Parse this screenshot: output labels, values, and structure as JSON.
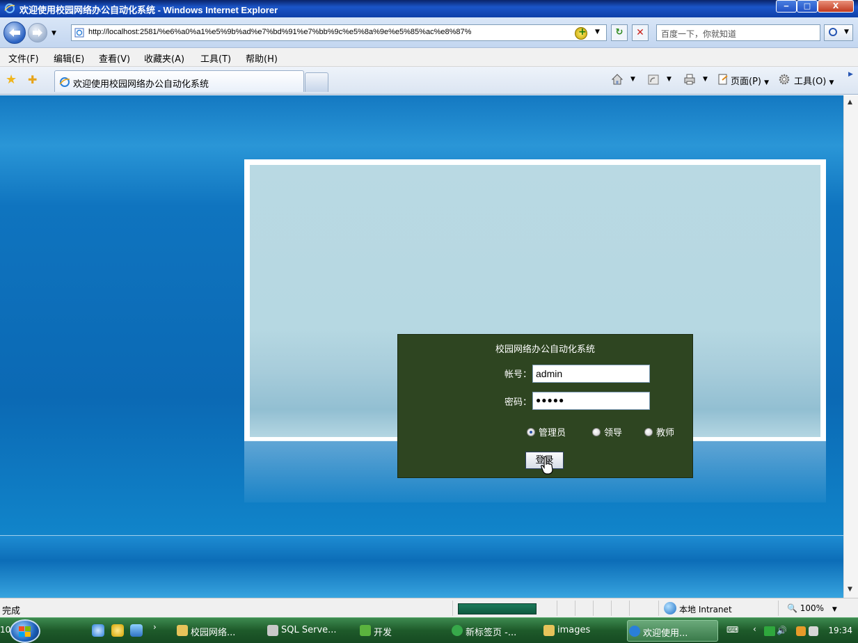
{
  "window": {
    "title": "欢迎使用校园网络办公自动化系统 - Windows Internet Explorer",
    "min_glyph": "‒",
    "max_glyph": "□",
    "close_glyph": "X"
  },
  "address_bar": {
    "url": "http://localhost:2581/%e6%a0%a1%e5%9b%ad%e7%bd%91%e7%bb%9c%e5%8a%9e%e5%85%ac%e8%87%",
    "search_placeholder": "百度一下，你就知道",
    "refresh_glyph": "↻",
    "stop_glyph": "✕"
  },
  "menu": {
    "items": [
      "文件(F)",
      "编辑(E)",
      "查看(V)",
      "收藏夹(A)",
      "工具(T)",
      "帮助(H)"
    ]
  },
  "tabs": {
    "active_label": "欢迎使用校园网络办公自动化系统",
    "page_label": "页面(P)",
    "tools_label": "工具(O)"
  },
  "login": {
    "system_title": "校园网络办公自动化系统",
    "account_label": "帐号：",
    "account_value": "admin",
    "password_label": "密码：",
    "password_value": "●●●●●",
    "roles": [
      {
        "label": "管理员",
        "selected": true
      },
      {
        "label": "领导",
        "selected": false
      },
      {
        "label": "教师",
        "selected": false
      }
    ],
    "login_button": "登录"
  },
  "status_bar": {
    "status": "完成",
    "zone": "本地 Intranet",
    "zoom": "100%"
  },
  "taskbar": {
    "clipped_left": "10",
    "items": [
      {
        "label": "校园网络...",
        "icon": "folder-project-icon"
      },
      {
        "label": "SQL Serve...",
        "icon": "sql-server-icon"
      },
      {
        "label": "开发",
        "icon": "tree-icon"
      },
      {
        "label": "新标签页 -...",
        "icon": "ie-icon"
      },
      {
        "label": "images",
        "icon": "folder-icon"
      },
      {
        "label": "欢迎使用...",
        "icon": "ie-icon"
      }
    ],
    "clock": "19:34"
  },
  "colors": {
    "login_bg": "#2e4521",
    "page_blue": "#0f74bf",
    "taskbar_green": "#1e5a2a"
  }
}
